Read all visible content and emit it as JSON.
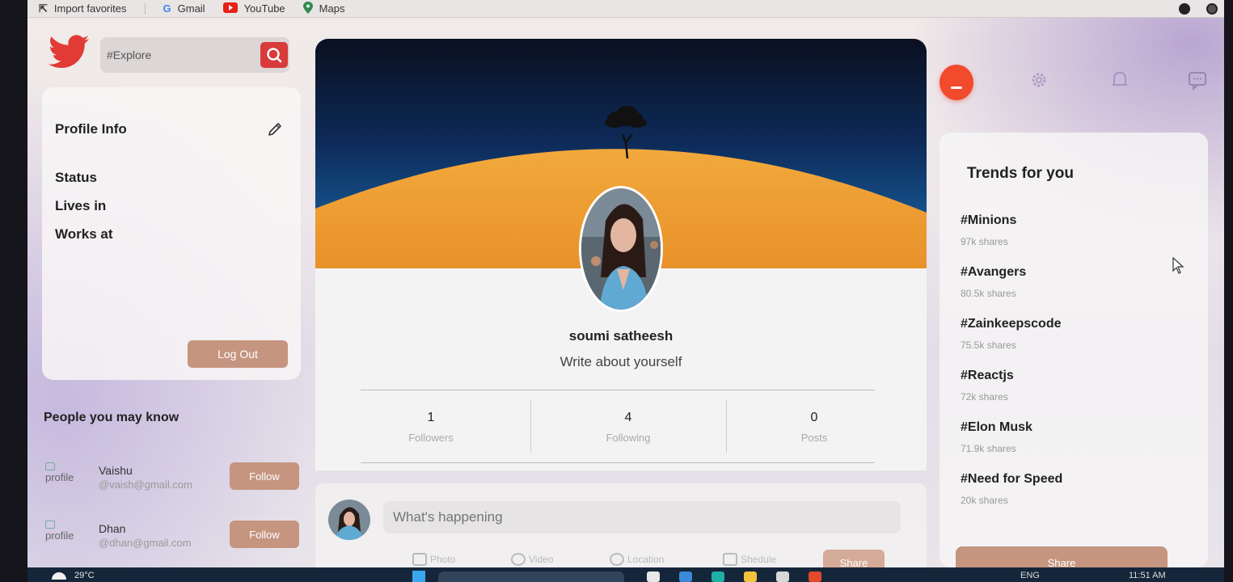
{
  "browser": {
    "bookmarks": [
      {
        "label": "Import favorites",
        "icon": "import-icon"
      },
      {
        "label": "Gmail",
        "icon": "google-icon"
      },
      {
        "label": "YouTube",
        "icon": "youtube-icon"
      },
      {
        "label": "Maps",
        "icon": "maps-icon"
      }
    ]
  },
  "colors": {
    "accent": "#c59580",
    "brand_red": "#d93a3a",
    "home_orange": "#f24a2c",
    "twitter_red": "#e23b35"
  },
  "search": {
    "value": "#Explore"
  },
  "profile_info": {
    "title": "Profile Info",
    "rows": [
      "Status",
      "Lives in",
      "Works at"
    ],
    "logout_label": "Log Out"
  },
  "people_you_may_know": {
    "title": "People you may know",
    "people": [
      {
        "img_alt": "profile",
        "name": "Vaishu",
        "email": "@vaish@gmail.com",
        "follow_label": "Follow"
      },
      {
        "img_alt": "profile",
        "name": "Dhan",
        "email": "@dhan@gmail.com",
        "follow_label": "Follow"
      }
    ]
  },
  "profile": {
    "name": "soumi satheesh",
    "bio": "Write about yourself",
    "stats": [
      {
        "value": "1",
        "label": "Followers"
      },
      {
        "value": "4",
        "label": "Following"
      },
      {
        "value": "0",
        "label": "Posts"
      }
    ]
  },
  "post_share": {
    "placeholder": "What's happening",
    "options": [
      {
        "label": "Photo",
        "icon": "photo-icon"
      },
      {
        "label": "Video",
        "icon": "play-circle-icon"
      },
      {
        "label": "Location",
        "icon": "location-icon"
      },
      {
        "label": "Shedule",
        "icon": "calendar-icon"
      }
    ],
    "share_label": "Share"
  },
  "nav": {
    "icons": [
      "home-icon",
      "settings-icon",
      "bell-icon",
      "comment-icon"
    ]
  },
  "trends": {
    "title": "Trends for you",
    "items": [
      {
        "tag": "#Minions",
        "shares": "97k shares"
      },
      {
        "tag": "#Avangers",
        "shares": "80.5k shares"
      },
      {
        "tag": "#Zainkeepscode",
        "shares": "75.5k shares"
      },
      {
        "tag": "#Reactjs",
        "shares": "72k shares"
      },
      {
        "tag": "#Elon Musk",
        "shares": "71.9k shares"
      },
      {
        "tag": "#Need for Speed",
        "shares": "20k shares"
      }
    ],
    "share_label": "Share"
  },
  "taskbar": {
    "temperature": "29°C",
    "language": "ENG",
    "time": "11:51 AM"
  }
}
